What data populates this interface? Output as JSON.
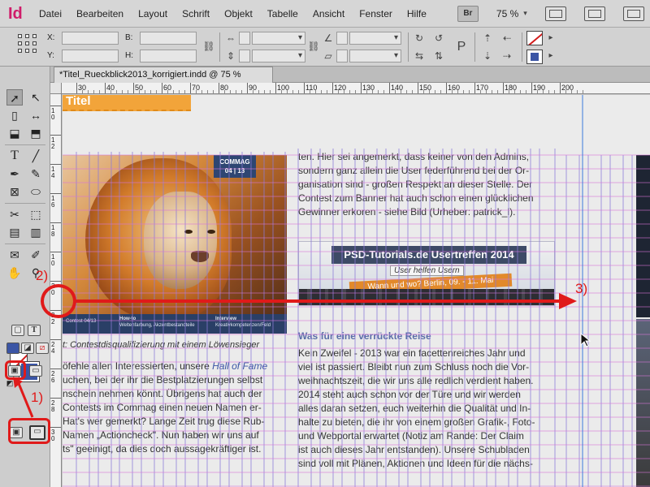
{
  "app": {
    "logo": "Id",
    "menu": [
      "Datei",
      "Bearbeiten",
      "Layout",
      "Schrift",
      "Objekt",
      "Tabelle",
      "Ansicht",
      "Fenster",
      "Hilfe"
    ],
    "bridge_label": "Br",
    "zoom": "75 %"
  },
  "controlbar": {
    "x_label": "X:",
    "y_label": "Y:",
    "b_label": "B:",
    "h_label": "H:",
    "p_label": "P"
  },
  "document": {
    "tab_title": "*Titel_Rueckblick2013_korrigiert.indd @ 75 %",
    "ruler_h": [
      "30",
      "40",
      "50",
      "60",
      "70",
      "80",
      "90",
      "100",
      "110",
      "120",
      "130",
      "140",
      "150",
      "160",
      "170",
      "180",
      "190",
      "200"
    ],
    "ruler_v": [
      "1\n0",
      "1\n2",
      "1\n4",
      "1\n6",
      "1\n8",
      "1\n0",
      "2\n0",
      "2\n2",
      "2\n4",
      "2\n6",
      "2\n8",
      "3\n0"
    ]
  },
  "page": {
    "title_box": "Titel",
    "badge_line1": "COMMAG",
    "badge_line2": "04 | 13",
    "strip_left": "Contest 04/13",
    "strip_mid_head": "How-to",
    "strip_mid_sub": "Weltenfarbung, Akzentbestandteile",
    "strip_right_head": "Interview",
    "strip_right_sub": "Kreativkompetenzen/Feld",
    "caption": "t: Contestdisqualifizierung mit einem Löwensieger",
    "left_column": [
      {
        "pre": "öfehle allen Interessierten, unsere ",
        "em": "Hall of Fame"
      },
      {
        "pre": "uchen, bei der ihr die Bestplatzierungen selbst",
        "em": ""
      },
      {
        "pre": "nschein nehmen könnt. Übrigens hat auch der",
        "em": ""
      },
      {
        "pre": "Contests im Commag einen neuen Namen er-",
        "em": ""
      },
      {
        "pre": "Hat's wer gemerkt? Lange Zeit trug diese Rub-",
        "em": ""
      },
      {
        "pre": "Namen „Actioncheck\". Nun haben wir uns auf",
        "em": ""
      },
      {
        "pre": "ts\" geeinigt, da dies doch aussagekräftiger ist.",
        "em": ""
      }
    ],
    "right_column_top": [
      "ten. Hier sei angemerkt, dass keiner von den Admins,",
      "sondern ganz allein die User federführend bei der Or-",
      "ganisation sind - großen Respekt an dieser Stelle. Der",
      "Contest zum Banner hat auch schon einen glücklichen",
      "Gewinner erkoren - siehe Bild (Urheber: patrick_l)."
    ],
    "banner_title": "PSD-Tutorials.de Usertreffen 2014",
    "banner_sub": "User helfen Usern",
    "banner_date": "Wann und wo? Berlin, 09. - 11. Mai",
    "section_head": "Was für eine verrückte Reise",
    "right_column_bottom": [
      "Kein Zweifel - 2013 war ein facettenreiches Jahr und",
      "viel ist passiert. Bleibt nun zum Schluss noch die Vor-",
      "weihnachtszeit, die wir uns alle redlich verdient haben.",
      "2014 steht auch schon vor der Türe und wir werden",
      "alles daran setzen, euch weiterhin die Qualität und In-",
      "halte zu bieten, die ihr von einem großen Grafik-, Foto-",
      "und Webportal erwartet (Notiz am Rande: Der Claim",
      "ist auch dieses Jahr entstanden). Unsere Schubladen",
      "sind voll mit Plänen, Aktionen und Ideen für die nächs-"
    ]
  },
  "annotations": {
    "one": "1)",
    "two": "2)",
    "three": "3)"
  }
}
